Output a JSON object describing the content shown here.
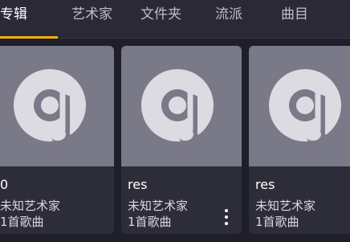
{
  "tabs": [
    {
      "label": "专辑",
      "active": true
    },
    {
      "label": "艺术家",
      "active": false
    },
    {
      "label": "文件夹",
      "active": false
    },
    {
      "label": "流派",
      "active": false
    },
    {
      "label": "曲目",
      "active": false
    }
  ],
  "albums": [
    {
      "title": "0",
      "artist": "未知艺术家",
      "track_count": "1首歌曲",
      "icon": "album-icon"
    },
    {
      "title": "res",
      "artist": "未知艺术家",
      "track_count": "1首歌曲",
      "icon": "album-icon"
    },
    {
      "title": "res",
      "artist": "未知艺术家",
      "track_count": "1首歌曲",
      "icon": "album-icon"
    }
  ],
  "colors": {
    "accent": "#f2b300",
    "background": "#1f1e2b",
    "card": "#2d2c39",
    "artwork": "#7a7988"
  }
}
